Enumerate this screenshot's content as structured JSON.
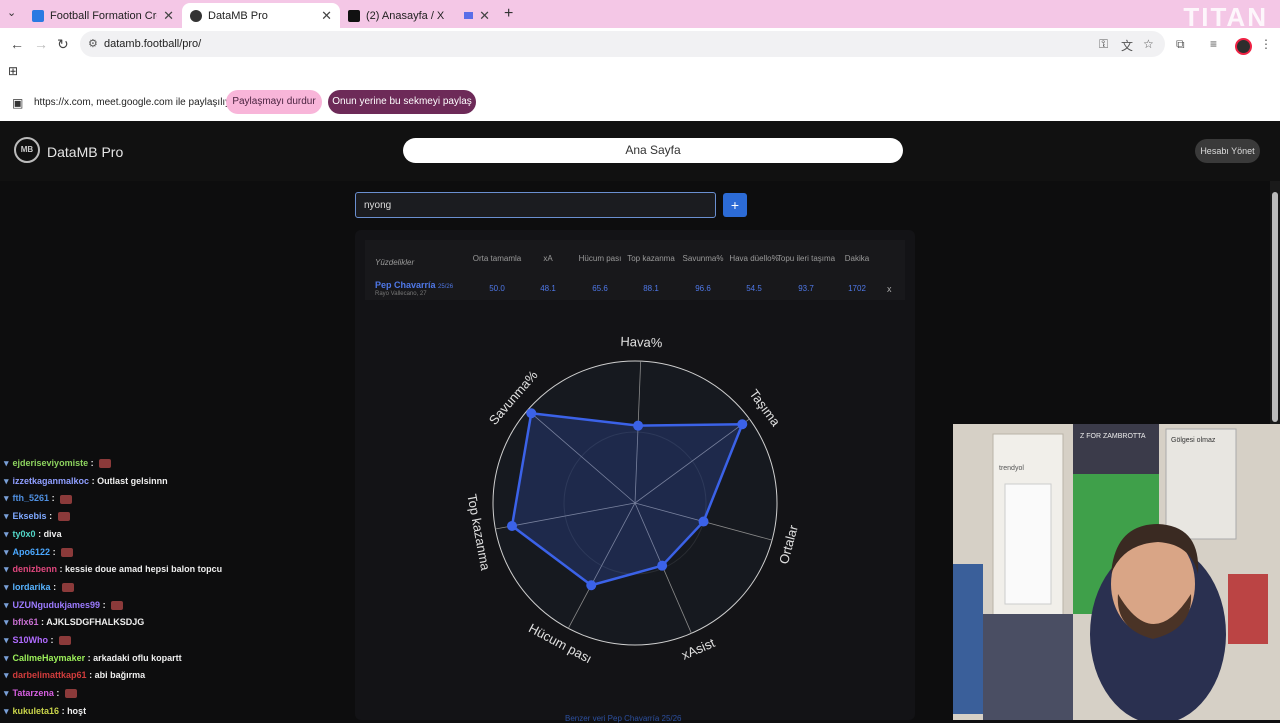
{
  "browser": {
    "tabs": [
      {
        "label": "Football Formation Creator: Re",
        "active": false
      },
      {
        "label": "DataMB Pro",
        "active": true
      },
      {
        "label": "(2) Anasayfa / X",
        "active": false
      }
    ],
    "watermark": "TITAN",
    "url": "datamb.football/pro/",
    "share_text": "https://x.com, meet.google.com ile paylaşılıyor",
    "stop_sharing_label": "Paylaşmayı durdur",
    "share_this_tab_label": "Onun yerine bu sekmeyi paylaş"
  },
  "app": {
    "logo_mark": "MB",
    "brand": "DataMB Pro",
    "home_label": "Ana Sayfa",
    "account_label": "Hesabı Yönet",
    "search_value": "nyong",
    "add_label": "+",
    "table": {
      "first_header": "Yüzdelikler",
      "headers": [
        "Orta tamamla",
        "xA",
        "Hücum pası",
        "Top kazanma",
        "Savunma%",
        "Hava düello%",
        "Topu ileri taşıma",
        "Dakika"
      ],
      "player": {
        "name": "Pep Chavarría",
        "season": "25/26",
        "club": "Rayo Vallecano, 27",
        "values": [
          "50.0",
          "48.1",
          "65.6",
          "88.1",
          "96.6",
          "54.5",
          "93.7",
          "1702"
        ]
      },
      "remove_label": "x"
    },
    "similar_text": "Benzer veri Pep Chavarría 25/26"
  },
  "chart_data": {
    "type": "radar",
    "axes": [
      "Hava%",
      "Taşıma",
      "Ortalar",
      "xAsist",
      "Hücum pası",
      "Top kazanma",
      "Savunma%"
    ],
    "rlim": [
      0,
      100
    ],
    "series": [
      {
        "values": [
          54.5,
          93.7,
          50.0,
          48.1,
          65.6,
          88.1,
          96.6
        ],
        "color": "#3b62e8"
      }
    ]
  },
  "chat": [
    {
      "user": "ejderiseviyomiste",
      "text": "",
      "color": "#8dd35f"
    },
    {
      "user": "izzetkaganmalkoc",
      "text": "Outlast gelsinnn",
      "color": "#8f9eff"
    },
    {
      "user": "fth_5261",
      "text": "",
      "color": "#4f8fe0"
    },
    {
      "user": "Eksebis",
      "text": "",
      "color": "#7fa9ff"
    },
    {
      "user": "ty0x0",
      "text": "diva",
      "color": "#52d6c8"
    },
    {
      "user": "Apo6122",
      "text": "",
      "color": "#4ba8ff"
    },
    {
      "user": "denizbenn",
      "text": "kessie doue amad hepsi balon topcu",
      "color": "#e0477e"
    },
    {
      "user": "lordarika",
      "text": "",
      "color": "#57b3ff"
    },
    {
      "user": "UZUNgudukjames99",
      "text": "",
      "color": "#9c7bff"
    },
    {
      "user": "bflx61",
      "text": "AJKLSDGFHALKSDJG",
      "color": "#c76fd1"
    },
    {
      "user": "S10Who",
      "text": "",
      "color": "#b06bff"
    },
    {
      "user": "CallmeHaymaker",
      "text": "arkadaki oflu kopartt",
      "color": "#9cf05a"
    },
    {
      "user": "darbelimattkap61",
      "text": "abi bağırma",
      "color": "#d13c3c"
    },
    {
      "user": "Tatarzena",
      "text": "",
      "color": "#d55fe0"
    },
    {
      "user": "kukuleta16",
      "text": "hoşt",
      "color": "#c9d44a"
    }
  ],
  "webcam": {
    "signs": [
      "Z FOR ZAMBROTTA",
      "Gölgesi olmaz",
      "trendyol"
    ]
  },
  "colors": {
    "accent": "#3b62e8",
    "tabbar": "#f4c7e6",
    "share_button": "#6d2a58"
  }
}
